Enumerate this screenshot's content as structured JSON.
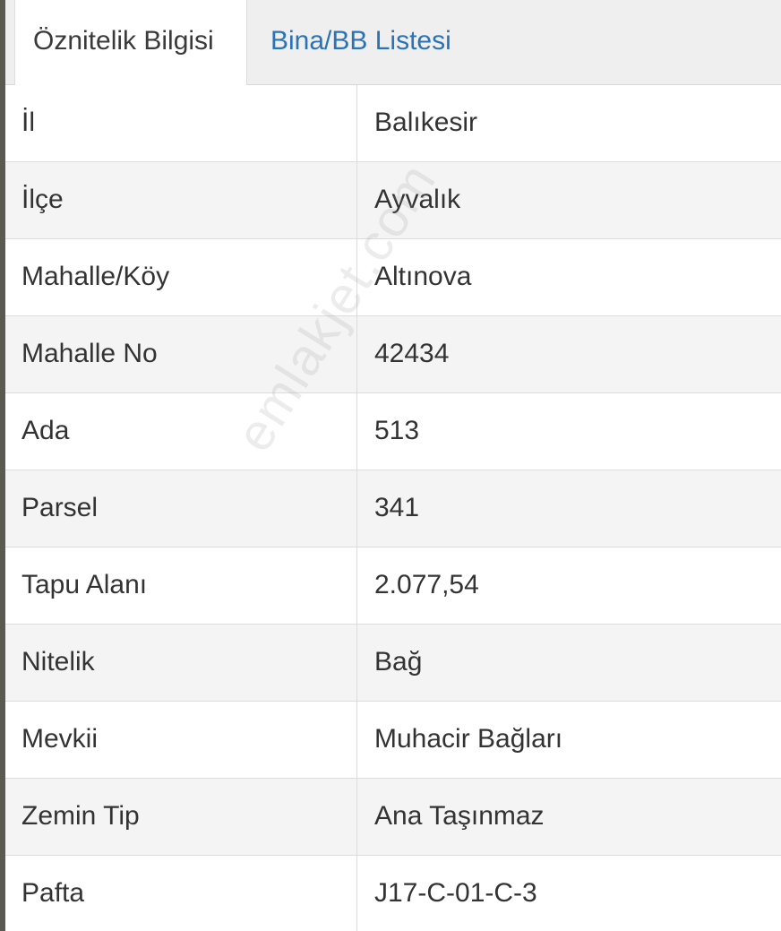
{
  "tabs": [
    {
      "label": "Öznitelik Bilgisi",
      "active": true
    },
    {
      "label": "Bina/BB Listesi",
      "active": false
    }
  ],
  "rows": [
    {
      "key": "İl",
      "value": "Balıkesir"
    },
    {
      "key": "İlçe",
      "value": "Ayvalık"
    },
    {
      "key": "Mahalle/Köy",
      "value": "Altınova"
    },
    {
      "key": "Mahalle No",
      "value": "42434"
    },
    {
      "key": "Ada",
      "value": "513"
    },
    {
      "key": "Parsel",
      "value": "341"
    },
    {
      "key": "Tapu Alanı",
      "value": "2.077,54"
    },
    {
      "key": "Nitelik",
      "value": "Bağ"
    },
    {
      "key": "Mevkii",
      "value": "Muhacir Bağları"
    },
    {
      "key": "Zemin Tip",
      "value": "Ana Taşınmaz"
    },
    {
      "key": "Pafta",
      "value": "J17-C-01-C-3"
    }
  ],
  "watermark": "emlakjet.com",
  "colors": {
    "tab_active_text": "#3a3a3a",
    "tab_inactive_text": "#2a73b8",
    "tabbar_bg": "#efefef",
    "row_alt_bg": "#f4f4f4",
    "border": "#dcdcdc",
    "text": "#333333"
  }
}
